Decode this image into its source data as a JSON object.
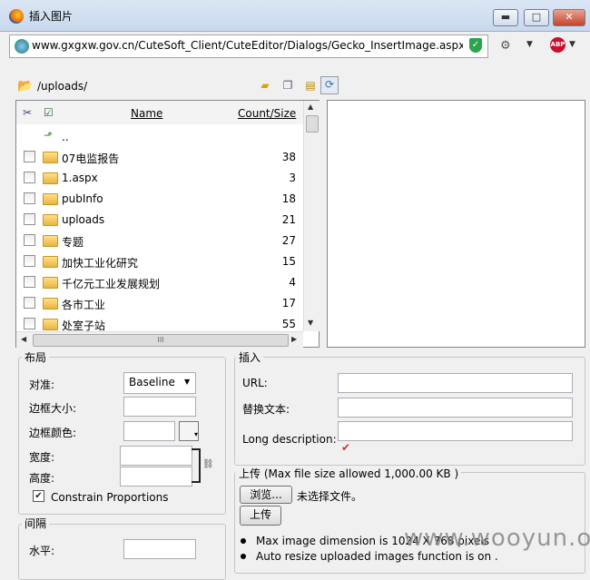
{
  "window": {
    "title": "插入图片",
    "min_glyph": "▬",
    "max_glyph": "□",
    "close_glyph": "✕"
  },
  "address_bar": {
    "url": "www.gxgxw.gov.cn/CuteSoft_Client/CuteEditor/Dialogs/Gecko_InsertImage.aspx?s",
    "abp_label": "ABP"
  },
  "browser": {
    "current_path": "/uploads/"
  },
  "file_list": {
    "columns": [
      "Name",
      "Count/Size"
    ],
    "parent_label": "..",
    "rows": [
      {
        "name": "07电监报告",
        "count": "38"
      },
      {
        "name": "1.aspx",
        "count": "3"
      },
      {
        "name": "pubInfo",
        "count": "18"
      },
      {
        "name": "uploads",
        "count": "21"
      },
      {
        "name": "专题",
        "count": "27"
      },
      {
        "name": "加快工业化研究",
        "count": "15"
      },
      {
        "name": "千亿元工业发展规划",
        "count": "4"
      },
      {
        "name": "各市工业",
        "count": "17"
      },
      {
        "name": "处室子站",
        "count": "55"
      }
    ]
  },
  "layout_panel": {
    "legend": "布局",
    "align_label": "对准:",
    "align_value": "Baseline",
    "border_size_label": "边框大小:",
    "border_color_label": "边框颜色:",
    "width_label": "宽度:",
    "height_label": "高度:",
    "constrain_label": "Constrain Proportions",
    "constrain_checked": true
  },
  "spacing_panel": {
    "legend": "间隔",
    "horizontal_label": "水平:"
  },
  "insert_panel": {
    "legend": "插入",
    "url_label": "URL:",
    "alt_label": "替换文本:",
    "long_desc_label": "Long description:"
  },
  "upload_panel": {
    "legend": "上传 (Max file size allowed 1,000.00 KB )",
    "browse_label": "浏览...",
    "no_file_label": "未选择文件。",
    "upload_button": "上传",
    "notes": [
      "Max image dimension is 1024 X 768 pixels",
      "Auto resize uploaded images function is on ."
    ]
  },
  "watermark": "www.wooyun.org",
  "colors": {
    "titlebar": "#c9d9ee",
    "close_button": "#c4432c",
    "folder": "#e8b540",
    "abp": "#c8102e",
    "shield": "#2ca44d"
  }
}
